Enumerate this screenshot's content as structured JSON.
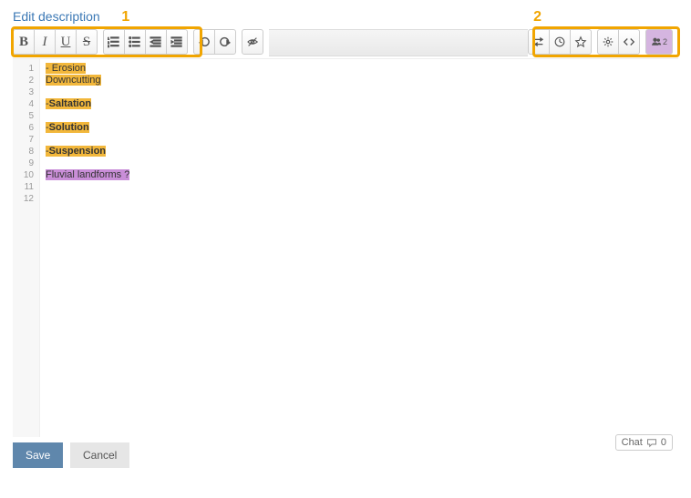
{
  "header": {
    "edit_description": "Edit description",
    "annotation_1": "1",
    "annotation_2": "2"
  },
  "toolbar": {
    "bold": "B",
    "italic": "I",
    "underline": "U",
    "strike": "S"
  },
  "editor": {
    "line_numbers": [
      "1",
      "2",
      "3",
      "4",
      "5",
      "6",
      "7",
      "8",
      "9",
      "10",
      "11",
      "12"
    ],
    "lines": [
      {
        "segments": [
          {
            "t": "- ",
            "hl": "hl-yellow"
          },
          {
            "t": "Erosion",
            "hl": "hl-yellow"
          }
        ]
      },
      {
        "segments": [
          {
            "t": "Downcutting",
            "hl": "hl-yellow"
          }
        ]
      },
      {
        "segments": []
      },
      {
        "segments": [
          {
            "t": "-",
            "hl": "hl-yellow"
          },
          {
            "t": "Saltation",
            "hl": "hl-yellow",
            "bold": true
          }
        ]
      },
      {
        "segments": []
      },
      {
        "segments": [
          {
            "t": "-",
            "hl": "hl-yellow"
          },
          {
            "t": "Solution",
            "hl": "hl-yellow",
            "bold": true
          }
        ]
      },
      {
        "segments": []
      },
      {
        "segments": [
          {
            "t": "-",
            "hl": "hl-yellow"
          },
          {
            "t": "Suspension",
            "hl": "hl-yellow",
            "bold": true
          }
        ]
      },
      {
        "segments": []
      },
      {
        "segments": [
          {
            "t": "Fluvial landforms ?",
            "hl": "hl-purple"
          }
        ]
      },
      {
        "segments": []
      },
      {
        "segments": []
      }
    ]
  },
  "chat": {
    "label": "Chat",
    "count": "0"
  },
  "footer": {
    "save": "Save",
    "cancel": "Cancel"
  },
  "users": {
    "count": "2"
  }
}
